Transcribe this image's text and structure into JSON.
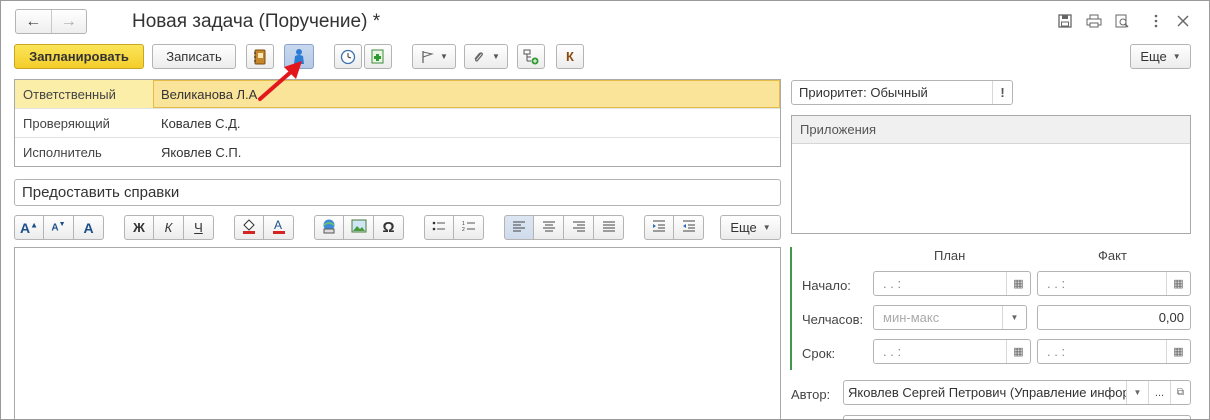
{
  "window": {
    "title": "Новая задача (Поручение) *",
    "nav_back": "←",
    "nav_forward": "→"
  },
  "toolbar": {
    "plan_label": "Запланировать",
    "save_label": "Записать",
    "more_label": "Еще",
    "k_label": "К"
  },
  "participants": [
    {
      "label": "Ответственный",
      "value": "Великанова Л.А."
    },
    {
      "label": "Проверяющий",
      "value": "Ковалев С.Д."
    },
    {
      "label": "Исполнитель",
      "value": "Яковлев С.П."
    }
  ],
  "subject": {
    "value": "Предоставить справки"
  },
  "format_toolbar": {
    "bold": "Ж",
    "italic": "К",
    "underline": "Ч",
    "special_char": "Ω",
    "more_label": "Еще"
  },
  "priority": {
    "value": "Приоритет: Обычный",
    "mark": "!"
  },
  "attachments": {
    "header": "Приложения"
  },
  "schedule": {
    "plan_header": "План",
    "fact_header": "Факт",
    "start_label": "Начало:",
    "hours_label": "Челчасов:",
    "deadline_label": "Срок:",
    "hours_placeholder": "мин-макс",
    "hours_fact_value": "0,00",
    "date_mask": ".   .      :"
  },
  "author": {
    "label": "Автор:",
    "value": "Яковлев Сергей Петрович (Управление инфорі",
    "ellipsis": "..."
  },
  "colors": {
    "accent_yellow": "#f4cd2a",
    "selection": "#fbeea9",
    "green_bar": "#3f9a4a",
    "arrow_red": "#e3161b"
  }
}
